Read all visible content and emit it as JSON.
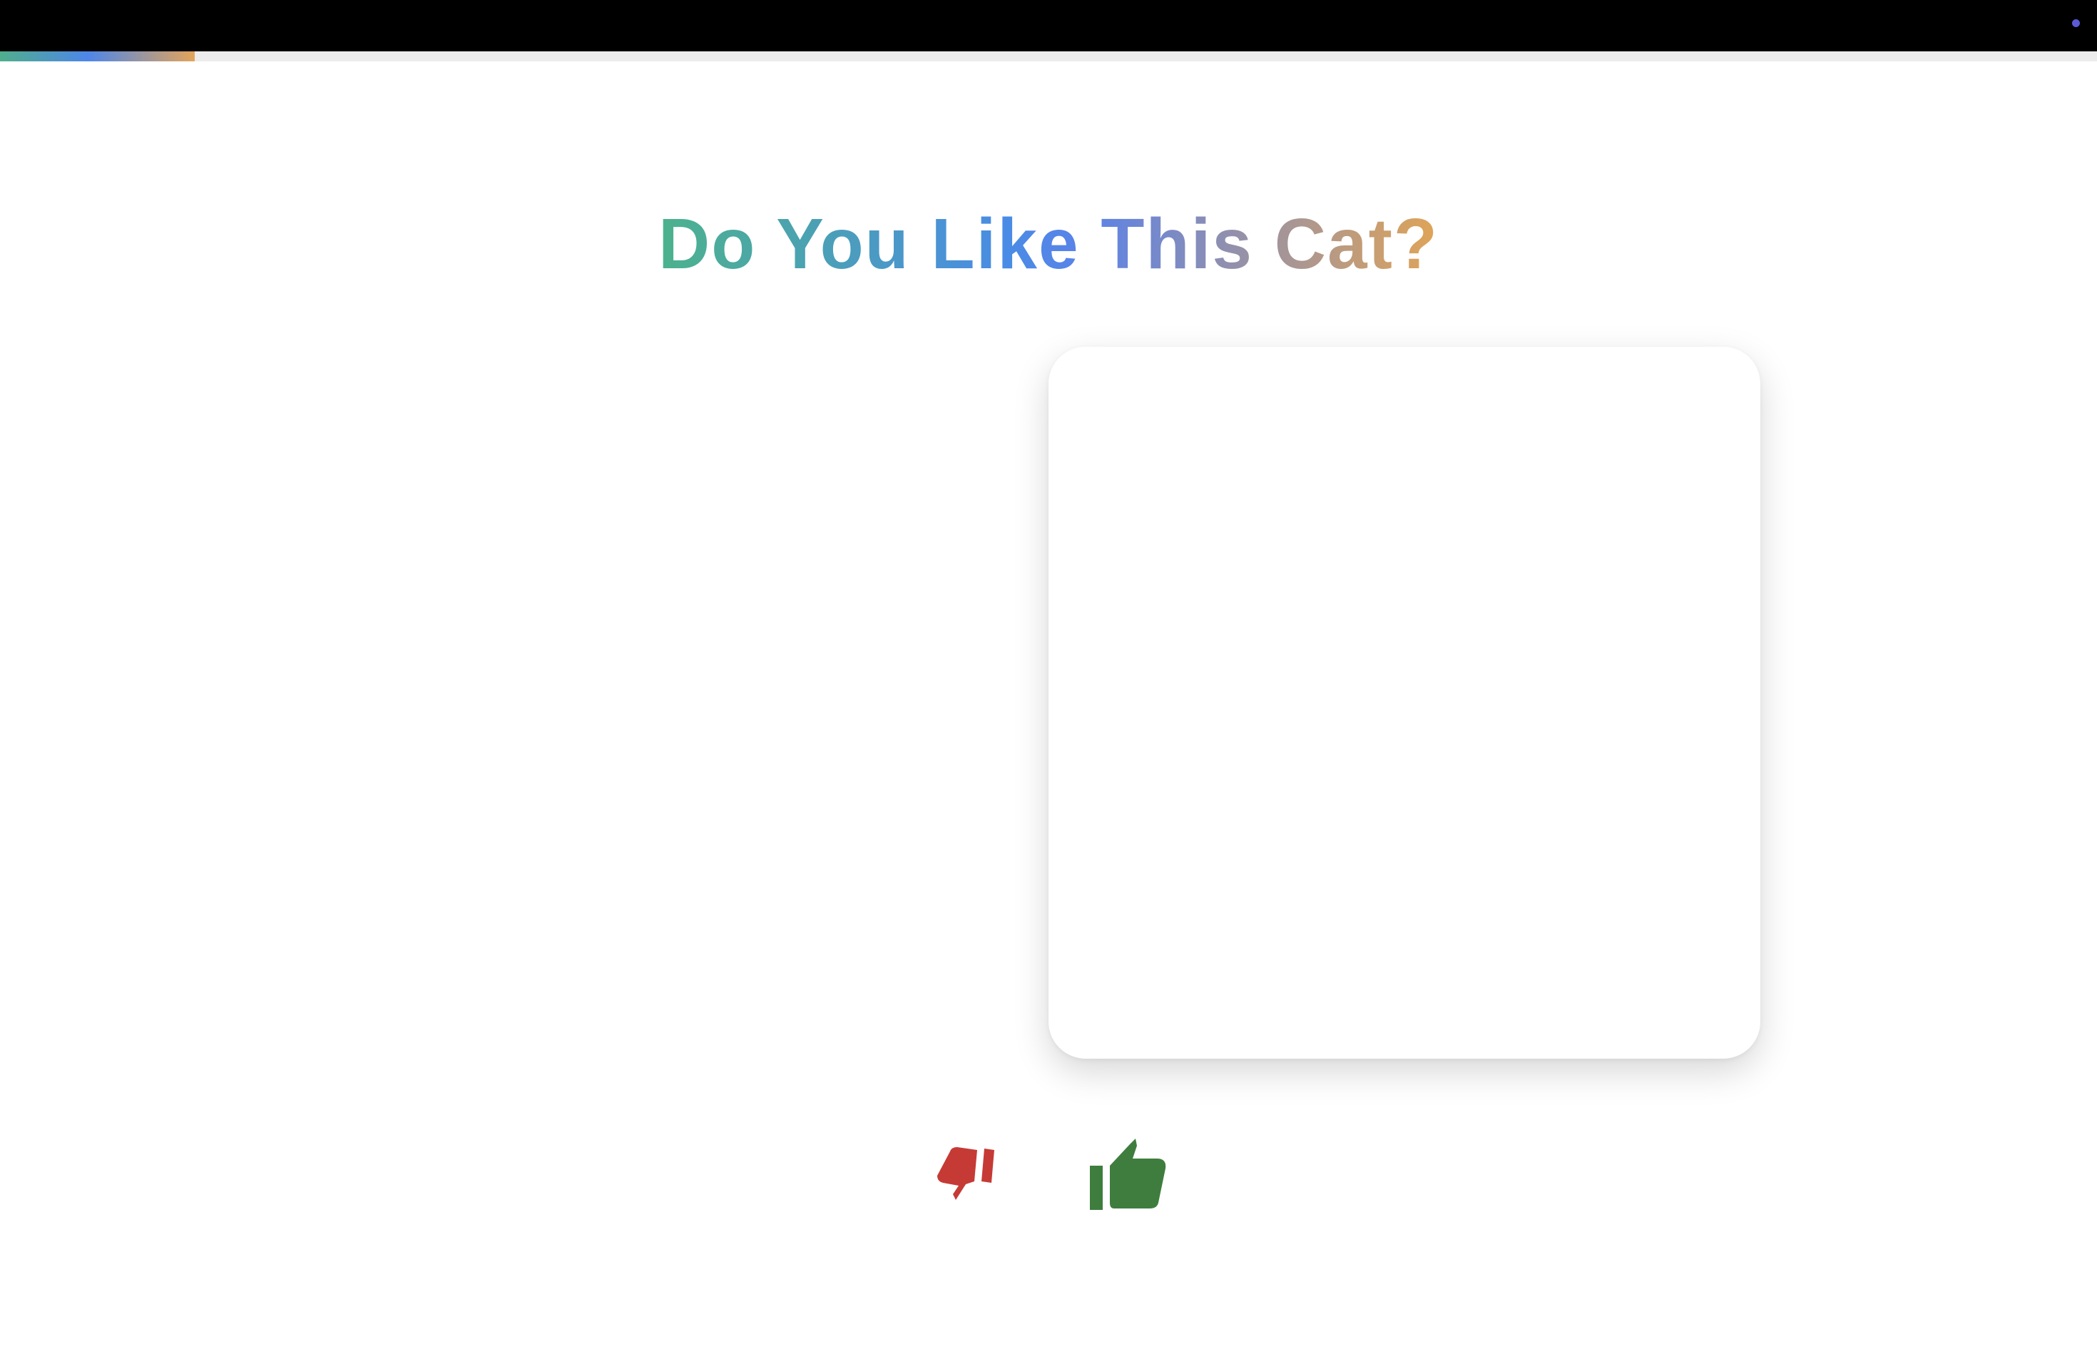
{
  "title": "Do You Like This Cat?",
  "progress": {
    "fraction": 0.093
  },
  "status": {
    "dot_color": "#5b5bd6"
  },
  "colors": {
    "top_bar": "#000000",
    "dislike": "#c63a35",
    "like": "#3f7d3e"
  },
  "buttons": {
    "dislike": {
      "icon": "thumbs-down-icon"
    },
    "like": {
      "icon": "thumbs-up-icon"
    }
  },
  "card": {
    "image": "cat-photo (blank)"
  }
}
